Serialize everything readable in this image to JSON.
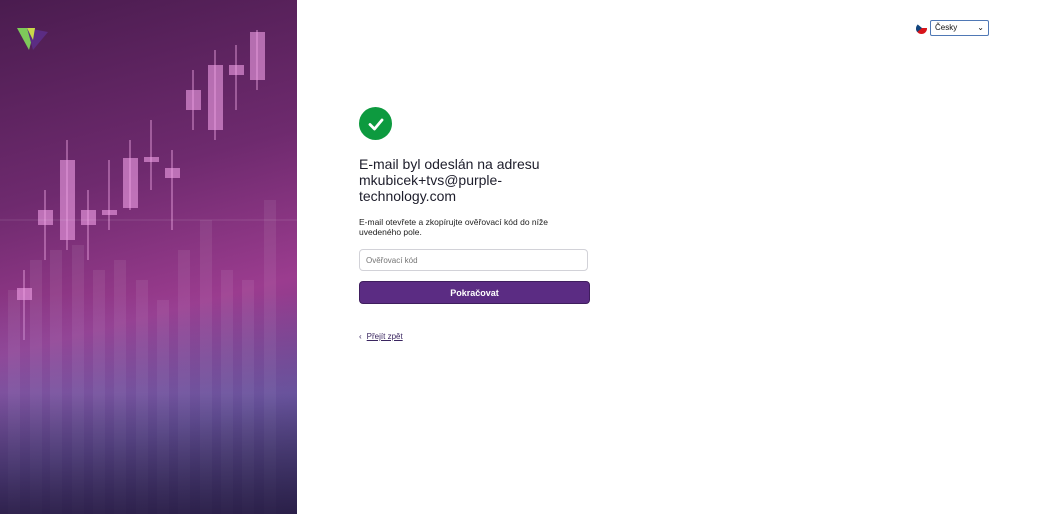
{
  "language": {
    "selected": "Česky",
    "flag_icon": "czech-flag-icon",
    "chevron_icon": "chevron-down-icon"
  },
  "main": {
    "success_icon": "checkmark-icon",
    "heading": "E-mail byl odeslán na adresu mkubicek+tvs@purple-technology.com",
    "instructions": "E-mail otevřete a zkopírujte ověřovací kód do níže uvedeného pole.",
    "code_placeholder": "Ověřovací kód",
    "continue_label": "Pokračovat",
    "back_label": "Přejít zpět",
    "back_icon": "chevron-left-icon"
  },
  "colors": {
    "primary_button": "#5b2c83",
    "success": "#0d9a3f",
    "panel_purple": "#9b3c8f"
  }
}
